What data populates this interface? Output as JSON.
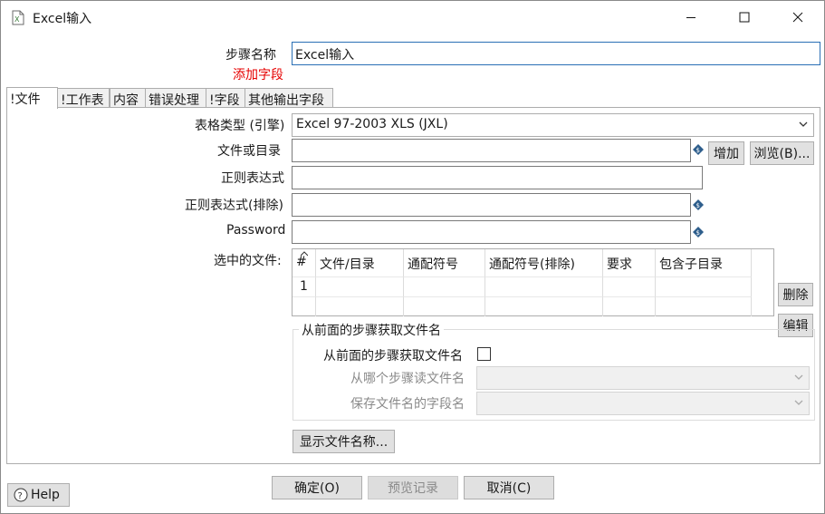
{
  "window": {
    "title": "Excel输入"
  },
  "step": {
    "label": "步骤名称",
    "value": "Excel输入",
    "add_fields_link": "添加字段"
  },
  "tabs": [
    "!文件",
    "!工作表",
    "内容",
    "错误处理",
    "!字段",
    "其他输出字段"
  ],
  "file_tab": {
    "sheet_type_label": "表格类型 (引擎)",
    "sheet_type_value": "Excel 97-2003 XLS (JXL)",
    "file_or_dir_label": "文件或目录",
    "add_button": "增加",
    "browse_button": "浏览(B)...",
    "regex_label": "正则表达式",
    "regex_exclude_label": "正则表达式(排除)",
    "password_label": "Password",
    "selected_files_label": "选中的文件:",
    "grid": {
      "columns": [
        "#",
        "文件/目录",
        "通配符号",
        "通配符号(排除)",
        "要求",
        "包含子目录"
      ],
      "rows": [
        [
          "1",
          "",
          "",
          "",
          "",
          ""
        ]
      ]
    },
    "delete_button": "删除",
    "edit_button": "编辑",
    "group": {
      "title": "从前面的步骤获取文件名",
      "checkbox_label": "从前面的步骤获取文件名",
      "checkbox_checked": false,
      "read_from_step_label": "从哪个步骤读文件名",
      "save_field_label": "保存文件名的字段名"
    },
    "show_filenames_button": "显示文件名称..."
  },
  "footer": {
    "help_button": "Help",
    "ok_button": "确定(O)",
    "preview_button": "预览记录",
    "cancel_button": "取消(C)"
  },
  "colors": {
    "link_red": "#e60000",
    "accent_blue": "#2a6fb5",
    "var_icon_blue": "#2e5e8c"
  }
}
